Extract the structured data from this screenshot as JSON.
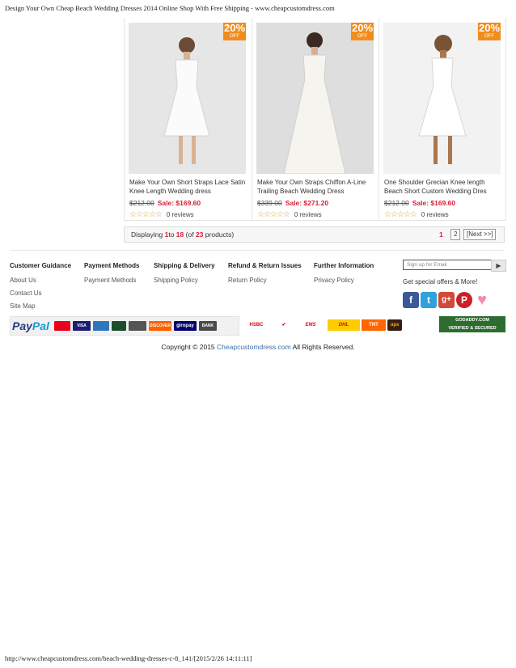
{
  "print_header": "Design Your Own Cheap Beach Wedding Dresses 2014 Online Shop With Free Shipping - www.cheapcustomdress.com",
  "print_footer": "http://www.cheapcustomdress.com/beach-wedding-dresses-c-8_141/[2015/2/26 14:11:11]",
  "products": [
    {
      "name": "Make Your Own Short Straps Lace Satin Knee Length Wedding dress",
      "old_price": "$212.00",
      "sale_price": "Sale: $169.60",
      "reviews": "0 reviews",
      "badge_pct": "20%",
      "badge_off": "OFF"
    },
    {
      "name": "Make Your Own Straps Chiffon A-Line Trailing Beach Wedding Dress",
      "old_price": "$339.00",
      "sale_price": "Sale: $271.20",
      "reviews": "0 reviews",
      "badge_pct": "20%",
      "badge_off": "OFF"
    },
    {
      "name": "One Shoulder Grecian Knee length Beach Short Custom Wedding Dres",
      "old_price": "$212.00",
      "sale_price": "Sale: $169.60",
      "reviews": "0 reviews",
      "badge_pct": "20%",
      "badge_off": "OFF"
    }
  ],
  "pager": {
    "displaying": "Displaying",
    "from": "1",
    "to_word": "to",
    "to": "18",
    "of_open": "(of",
    "total": "23",
    "products_close": "products)",
    "current_page": "1",
    "page2": "2",
    "next": "[Next >>]"
  },
  "footer": {
    "columns": [
      {
        "heading": "Customer Guidance",
        "links": [
          "About Us",
          "Contact Us",
          "Site Map"
        ]
      },
      {
        "heading": "Payment Methods",
        "links": [
          "Payment Methods"
        ]
      },
      {
        "heading": "Shipping & Delivery",
        "links": [
          "Shipping Policy"
        ]
      },
      {
        "heading": "Refund & Return Issues",
        "links": [
          "Return Policy"
        ]
      },
      {
        "heading": "Further Information",
        "links": [
          "Privacy Policy"
        ]
      }
    ],
    "email_placeholder": "Sign up for Email",
    "offers_text": "Get special offers & More!",
    "social": [
      {
        "name": "facebook-icon",
        "glyph": "f",
        "color": "#3b5998"
      },
      {
        "name": "twitter-icon",
        "glyph": "t",
        "color": "#2ea3db"
      },
      {
        "name": "google-plus-icon",
        "glyph": "g+",
        "color": "#d34836"
      },
      {
        "name": "pinterest-icon",
        "glyph": "P",
        "color": "#cb2027"
      },
      {
        "name": "heart-icon",
        "glyph": "♥",
        "color": "#f28cb1"
      }
    ]
  },
  "payment_logos": {
    "paypal_pay": "Pay",
    "paypal_pal": "Pal",
    "cards": [
      "",
      "VISA",
      "",
      "",
      "DISCOVER",
      "giropay",
      "BANK"
    ],
    "shipping": [
      "HSBC",
      "",
      "EMS",
      "DHL",
      "TNT",
      "ups"
    ],
    "secure": [
      "GODADDY.COM",
      "VERIFIED & SECURED"
    ]
  },
  "colors": {
    "accent_red": "#d8203a",
    "badge_orange": "#f08d1d",
    "link_blue": "#3b6ea8"
  },
  "copyright": {
    "prefix": "Copyright © 2015",
    "site": "Cheapcustomdress.com",
    "suffix": "All Rights Reserved."
  }
}
